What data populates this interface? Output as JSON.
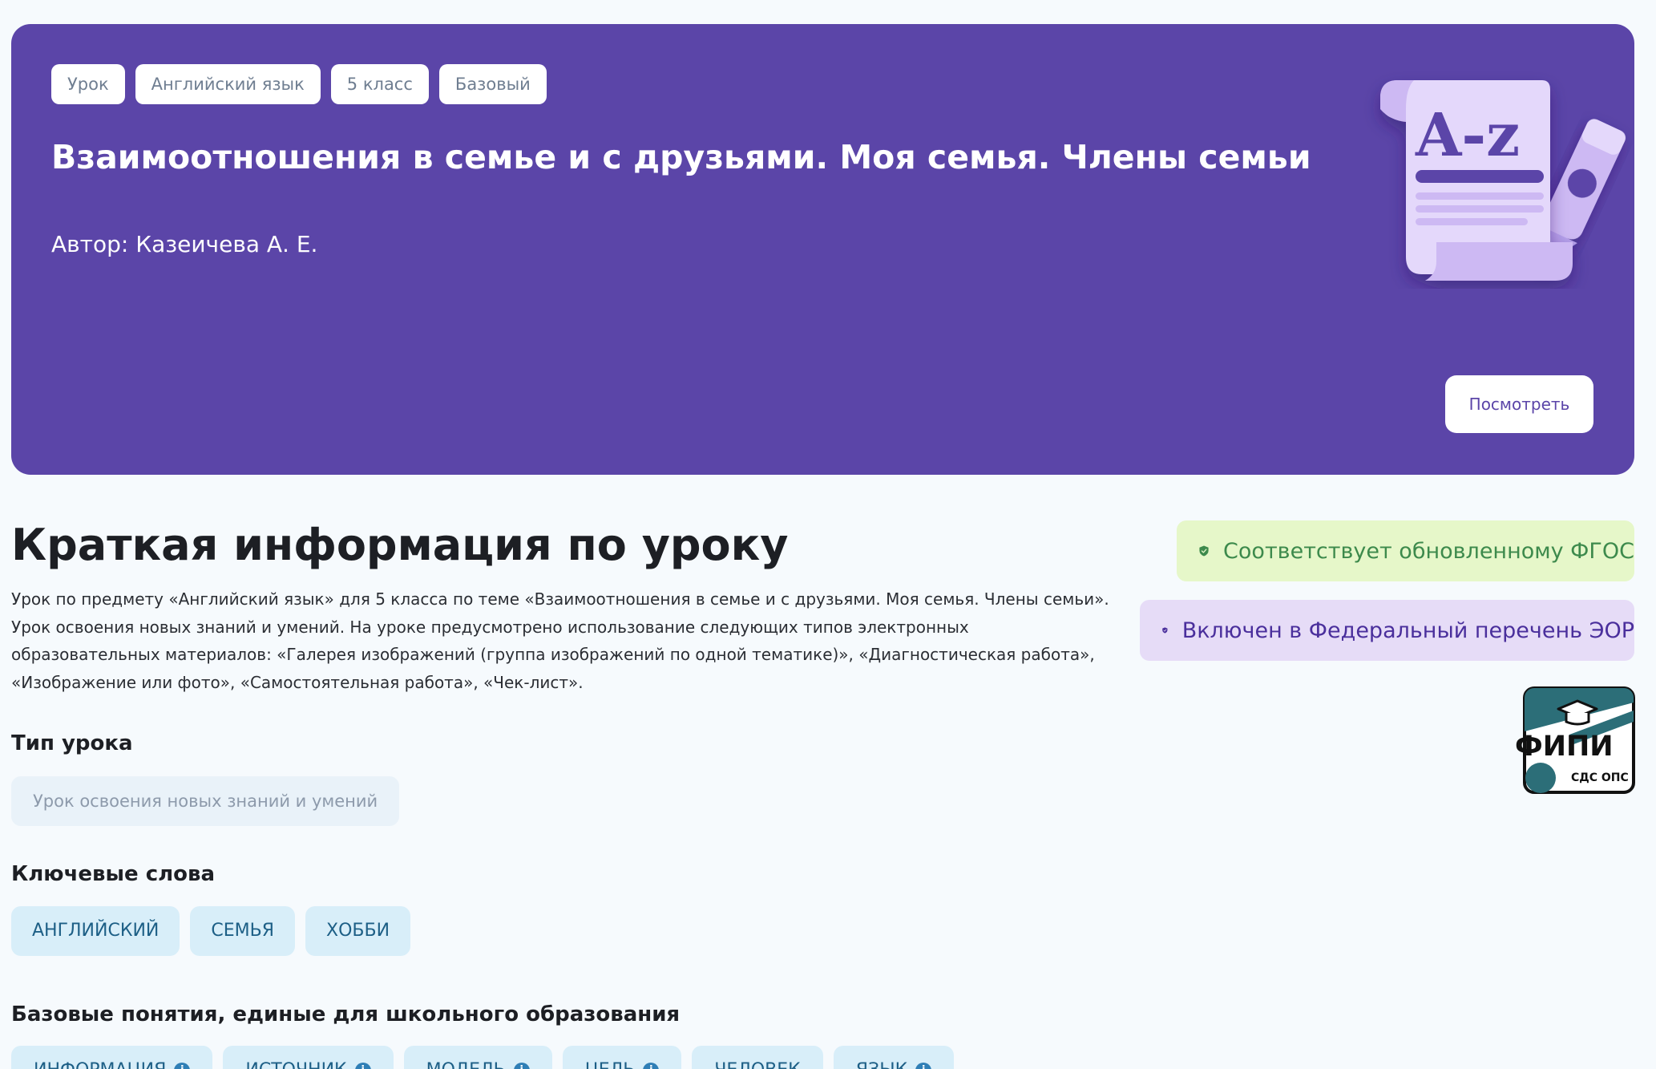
{
  "hero": {
    "tags": [
      "Урок",
      "Английский язык",
      "5 класс",
      "Базовый"
    ],
    "title": "Взаимоотношения в семье и с друзьями. Моя семья. Члены семьи",
    "author": "Автор: Казеичева А. Е.",
    "view_button": "Посмотреть",
    "illustration_text": "A-z",
    "illustration_icon": "dictionary-scroll-icon"
  },
  "summary": {
    "title": "Краткая информация по уроку",
    "description": "Урок по предмету «Английский язык» для 5 класса по теме «Взаимоотношения в семье и с друзьями. Моя семья. Члены семьи». Урок освоения новых знаний и умений. На уроке предусмотрено использование следующих типов электронных образовательных материалов: «Галерея изображений (группа изображений по одной тематике)», «Диагностическая работа», «Изображение или фото», «Самостоятельная работа», «Чек-лист»."
  },
  "lesson_type": {
    "heading": "Тип урока",
    "value": "Урок освоения новых знаний и умений"
  },
  "keywords": {
    "heading": "Ключевые слова",
    "items": [
      "АНГЛИЙСКИЙ",
      "СЕМЬЯ",
      "ХОББИ"
    ]
  },
  "basic_concepts": {
    "heading": "Базовые понятия, единые для школьного образования",
    "items": [
      "ИНФОРМАЦИЯ",
      "ИСТОЧНИК",
      "МОДЕЛЬ",
      "ЦЕЛЬ",
      "ЧЕЛОВЕК",
      "ЯЗЫК"
    ]
  },
  "badges": {
    "fgos": "Соответствует обновленному ФГОС",
    "eor": "Включен в Федеральный перечень ЭОР"
  },
  "fipi_logo": {
    "title": "ФИПИ",
    "subtitle": "СДС ОПС",
    "icon": "graduation-cap-icon"
  },
  "colors": {
    "hero_bg": "#5b45a8",
    "page_bg": "#f6fafd",
    "chip_bg": "#d8eef9",
    "chip_text": "#1d5f86",
    "fgos_bg": "#e6f7c9",
    "fgos_text": "#3d8a4c",
    "eor_bg": "#e6dcf7",
    "eor_text": "#4a2f9c",
    "fipi_teal": "#2c6e78"
  }
}
